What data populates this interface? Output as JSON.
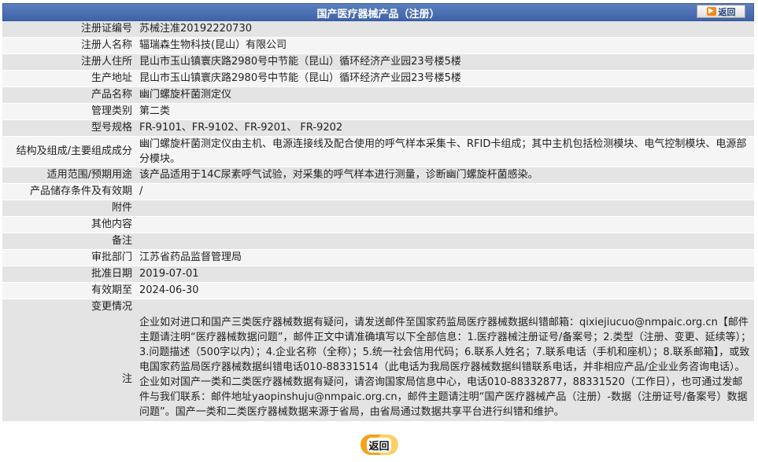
{
  "header": {
    "title": "国产医疗器械产品（注册）",
    "back_label": "返回",
    "back_icon": "▶"
  },
  "rows": [
    {
      "label": "注册证编号",
      "value": "苏械注准20192220730"
    },
    {
      "label": "注册人名称",
      "value": "辐瑞森生物科技(昆山）有限公司"
    },
    {
      "label": "注册人住所",
      "value": "昆山市玉山镇寰庆路2980号中节能（昆山）循环经济产业园23号楼5楼"
    },
    {
      "label": "生产地址",
      "value": "昆山市玉山镇寰庆路2980号中节能（昆山）循环经济产业园23号楼5楼"
    },
    {
      "label": "产品名称",
      "value": "幽门螺旋杆菌测定仪"
    },
    {
      "label": "管理类别",
      "value": "第二类"
    },
    {
      "label": "型号规格",
      "value": "FR-9101、FR-9102、FR-9201、 FR-9202"
    },
    {
      "label": "结构及组成/主要组成成分",
      "value": "幽门螺旋杆菌测定仪由主机、电源连接线及配合使用的呼气样本采集卡、RFID卡组成；其中主机包括检测模块、电气控制模块、电源部分模块。"
    },
    {
      "label": "适用范围/预期用途",
      "value": "该产品适用于14C尿素呼气试验，对采集的呼气样本进行测量，诊断幽门螺旋杆菌感染。"
    },
    {
      "label": "产品储存条件及有效期",
      "value": "/"
    },
    {
      "label": "附件",
      "value": ""
    },
    {
      "label": "其他内容",
      "value": ""
    },
    {
      "label": "备注",
      "value": ""
    },
    {
      "label": "审批部门",
      "value": "江苏省药品监督管理局"
    },
    {
      "label": "批准日期",
      "value": "2019-07-01"
    },
    {
      "label": "有效期至",
      "value": "2024-06-30"
    },
    {
      "label": "变更情况",
      "value": ""
    }
  ],
  "note": {
    "label": "注",
    "text": "企业如对进口和国产三类医疗器械数据有疑问，请发送邮件至国家药监局医疗器械数据纠错邮箱：qixiejiucuo@nmpaic.org.cn【邮件主题请注明“医疗器械数据问题”，邮件正文中请准确填写以下全部信息：1.医疗器械注册证号/备案号；2.类型（注册、变更、延续等）；3.问题描述（500字以内）；4.企业名称（全称）；5.统一社会信用代码；6.联系人姓名；7.联系电话（手机和座机）；8.联系邮箱】，或致电国家药监局医疗器械数据纠错电话010-88331514（此电话为我局医疗器械数据纠错联系电话，并非相应产品/企业业务咨询电话）。企业如对国产一类和二类医疗器械数据有疑问，请咨询国家局信息中心，电话010-88332877，88331520（工作日），也可通过发邮件与我们联系：邮件地址yaopinshuju@nmpaic.org.cn，邮件主题请注明“国产医疗器械产品（注册）-数据（注册证号/备案号）数据问题”。国产一类和二类医疗器械数据来源于省局，由省局通过数据共享平台进行纠错和维护。"
  },
  "footer": {
    "back_label": "返回"
  }
}
